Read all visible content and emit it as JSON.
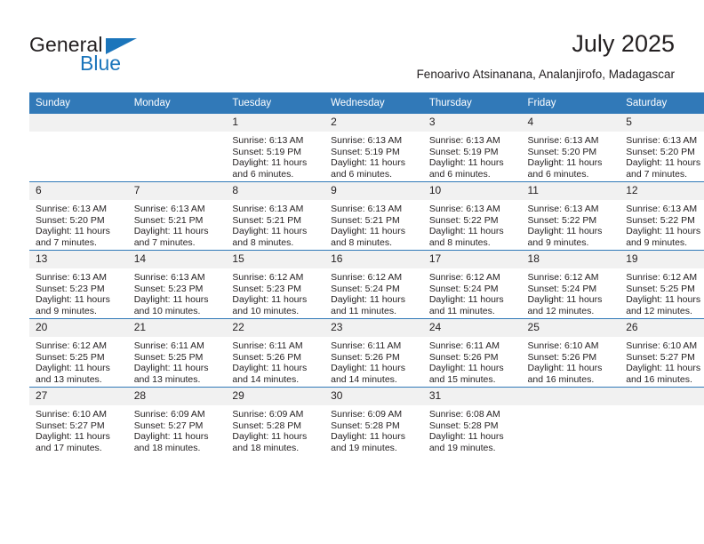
{
  "brand": {
    "word_one": "General",
    "word_two": "Blue",
    "logo_icon": "triangle-flag-icon"
  },
  "header": {
    "title": "July 2025",
    "subtitle": "Fenoarivo Atsinanana, Analanjirofo, Madagascar"
  },
  "colors": {
    "header_blue": "#3179b8",
    "brand_blue": "#1b75bb",
    "date_band": "#f1f1f1",
    "text": "#231f20"
  },
  "weekday_headers": [
    "Sunday",
    "Monday",
    "Tuesday",
    "Wednesday",
    "Thursday",
    "Friday",
    "Saturday"
  ],
  "weeks": [
    [
      {
        "day": "",
        "sunrise": "",
        "sunset": "",
        "daylight": ""
      },
      {
        "day": "",
        "sunrise": "",
        "sunset": "",
        "daylight": ""
      },
      {
        "day": "1",
        "sunrise": "Sunrise: 6:13 AM",
        "sunset": "Sunset: 5:19 PM",
        "daylight": "Daylight: 11 hours and 6 minutes."
      },
      {
        "day": "2",
        "sunrise": "Sunrise: 6:13 AM",
        "sunset": "Sunset: 5:19 PM",
        "daylight": "Daylight: 11 hours and 6 minutes."
      },
      {
        "day": "3",
        "sunrise": "Sunrise: 6:13 AM",
        "sunset": "Sunset: 5:19 PM",
        "daylight": "Daylight: 11 hours and 6 minutes."
      },
      {
        "day": "4",
        "sunrise": "Sunrise: 6:13 AM",
        "sunset": "Sunset: 5:20 PM",
        "daylight": "Daylight: 11 hours and 6 minutes."
      },
      {
        "day": "5",
        "sunrise": "Sunrise: 6:13 AM",
        "sunset": "Sunset: 5:20 PM",
        "daylight": "Daylight: 11 hours and 7 minutes."
      }
    ],
    [
      {
        "day": "6",
        "sunrise": "Sunrise: 6:13 AM",
        "sunset": "Sunset: 5:20 PM",
        "daylight": "Daylight: 11 hours and 7 minutes."
      },
      {
        "day": "7",
        "sunrise": "Sunrise: 6:13 AM",
        "sunset": "Sunset: 5:21 PM",
        "daylight": "Daylight: 11 hours and 7 minutes."
      },
      {
        "day": "8",
        "sunrise": "Sunrise: 6:13 AM",
        "sunset": "Sunset: 5:21 PM",
        "daylight": "Daylight: 11 hours and 8 minutes."
      },
      {
        "day": "9",
        "sunrise": "Sunrise: 6:13 AM",
        "sunset": "Sunset: 5:21 PM",
        "daylight": "Daylight: 11 hours and 8 minutes."
      },
      {
        "day": "10",
        "sunrise": "Sunrise: 6:13 AM",
        "sunset": "Sunset: 5:22 PM",
        "daylight": "Daylight: 11 hours and 8 minutes."
      },
      {
        "day": "11",
        "sunrise": "Sunrise: 6:13 AM",
        "sunset": "Sunset: 5:22 PM",
        "daylight": "Daylight: 11 hours and 9 minutes."
      },
      {
        "day": "12",
        "sunrise": "Sunrise: 6:13 AM",
        "sunset": "Sunset: 5:22 PM",
        "daylight": "Daylight: 11 hours and 9 minutes."
      }
    ],
    [
      {
        "day": "13",
        "sunrise": "Sunrise: 6:13 AM",
        "sunset": "Sunset: 5:23 PM",
        "daylight": "Daylight: 11 hours and 9 minutes."
      },
      {
        "day": "14",
        "sunrise": "Sunrise: 6:13 AM",
        "sunset": "Sunset: 5:23 PM",
        "daylight": "Daylight: 11 hours and 10 minutes."
      },
      {
        "day": "15",
        "sunrise": "Sunrise: 6:12 AM",
        "sunset": "Sunset: 5:23 PM",
        "daylight": "Daylight: 11 hours and 10 minutes."
      },
      {
        "day": "16",
        "sunrise": "Sunrise: 6:12 AM",
        "sunset": "Sunset: 5:24 PM",
        "daylight": "Daylight: 11 hours and 11 minutes."
      },
      {
        "day": "17",
        "sunrise": "Sunrise: 6:12 AM",
        "sunset": "Sunset: 5:24 PM",
        "daylight": "Daylight: 11 hours and 11 minutes."
      },
      {
        "day": "18",
        "sunrise": "Sunrise: 6:12 AM",
        "sunset": "Sunset: 5:24 PM",
        "daylight": "Daylight: 11 hours and 12 minutes."
      },
      {
        "day": "19",
        "sunrise": "Sunrise: 6:12 AM",
        "sunset": "Sunset: 5:25 PM",
        "daylight": "Daylight: 11 hours and 12 minutes."
      }
    ],
    [
      {
        "day": "20",
        "sunrise": "Sunrise: 6:12 AM",
        "sunset": "Sunset: 5:25 PM",
        "daylight": "Daylight: 11 hours and 13 minutes."
      },
      {
        "day": "21",
        "sunrise": "Sunrise: 6:11 AM",
        "sunset": "Sunset: 5:25 PM",
        "daylight": "Daylight: 11 hours and 13 minutes."
      },
      {
        "day": "22",
        "sunrise": "Sunrise: 6:11 AM",
        "sunset": "Sunset: 5:26 PM",
        "daylight": "Daylight: 11 hours and 14 minutes."
      },
      {
        "day": "23",
        "sunrise": "Sunrise: 6:11 AM",
        "sunset": "Sunset: 5:26 PM",
        "daylight": "Daylight: 11 hours and 14 minutes."
      },
      {
        "day": "24",
        "sunrise": "Sunrise: 6:11 AM",
        "sunset": "Sunset: 5:26 PM",
        "daylight": "Daylight: 11 hours and 15 minutes."
      },
      {
        "day": "25",
        "sunrise": "Sunrise: 6:10 AM",
        "sunset": "Sunset: 5:26 PM",
        "daylight": "Daylight: 11 hours and 16 minutes."
      },
      {
        "day": "26",
        "sunrise": "Sunrise: 6:10 AM",
        "sunset": "Sunset: 5:27 PM",
        "daylight": "Daylight: 11 hours and 16 minutes."
      }
    ],
    [
      {
        "day": "27",
        "sunrise": "Sunrise: 6:10 AM",
        "sunset": "Sunset: 5:27 PM",
        "daylight": "Daylight: 11 hours and 17 minutes."
      },
      {
        "day": "28",
        "sunrise": "Sunrise: 6:09 AM",
        "sunset": "Sunset: 5:27 PM",
        "daylight": "Daylight: 11 hours and 18 minutes."
      },
      {
        "day": "29",
        "sunrise": "Sunrise: 6:09 AM",
        "sunset": "Sunset: 5:28 PM",
        "daylight": "Daylight: 11 hours and 18 minutes."
      },
      {
        "day": "30",
        "sunrise": "Sunrise: 6:09 AM",
        "sunset": "Sunset: 5:28 PM",
        "daylight": "Daylight: 11 hours and 19 minutes."
      },
      {
        "day": "31",
        "sunrise": "Sunrise: 6:08 AM",
        "sunset": "Sunset: 5:28 PM",
        "daylight": "Daylight: 11 hours and 19 minutes."
      },
      {
        "day": "",
        "sunrise": "",
        "sunset": "",
        "daylight": ""
      },
      {
        "day": "",
        "sunrise": "",
        "sunset": "",
        "daylight": ""
      }
    ]
  ]
}
